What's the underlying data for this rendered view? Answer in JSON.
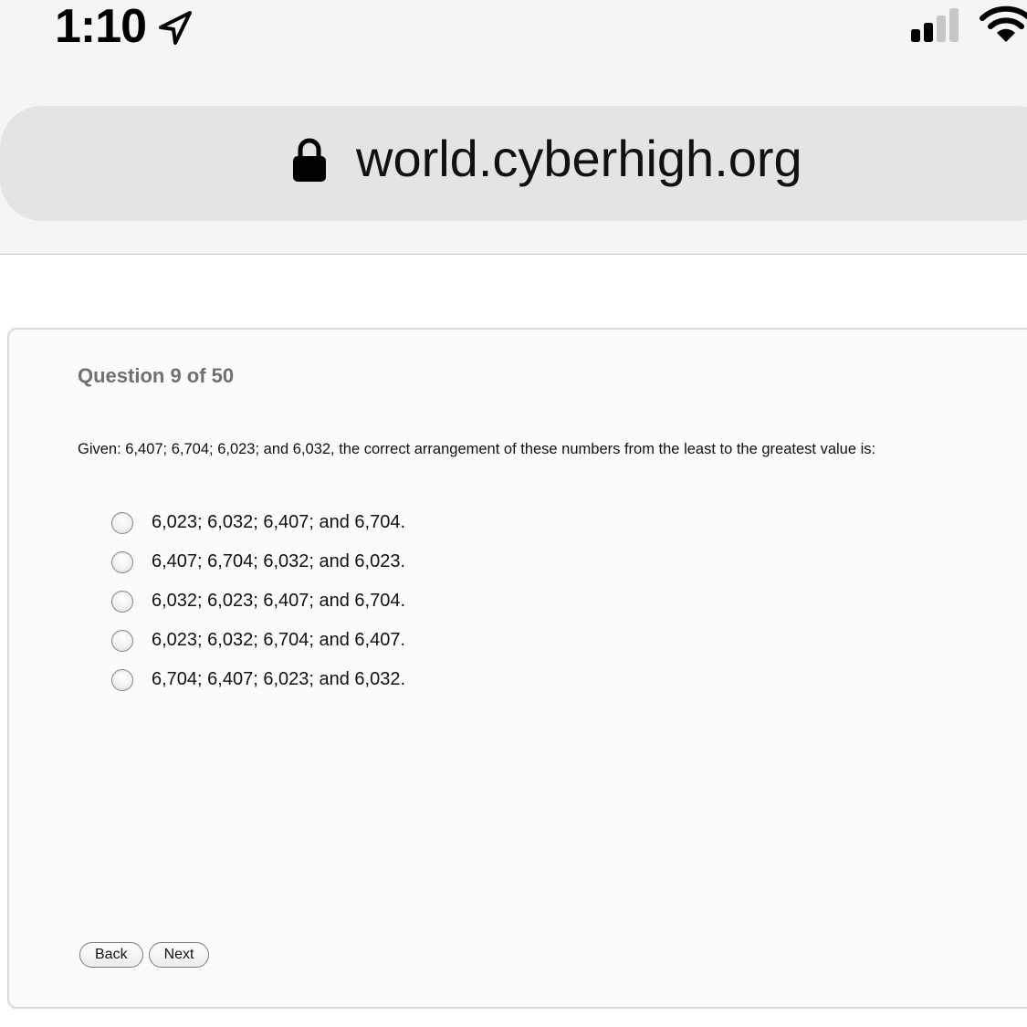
{
  "status_bar": {
    "time": "1:10",
    "location_icon": "location-arrow-icon",
    "signal_icon": "cellular-signal-icon",
    "wifi_icon": "wifi-icon"
  },
  "browser": {
    "url": "world.cyberhigh.org",
    "lock_icon": "lock-icon"
  },
  "quiz": {
    "question_label": "Question 9 of 50",
    "question_text": "Given: 6,407; 6,704; 6,023; and 6,032, the correct arrangement of these numbers from the least to the greatest value is:",
    "options": [
      "6,023; 6,032; 6,407; and 6,704.",
      "6,407; 6,704; 6,032; and 6,023.",
      "6,032; 6,023; 6,407; and 6,704.",
      "6,023; 6,032; 6,704; and 6,407.",
      "6,704; 6,407; 6,023; and 6,032."
    ],
    "buttons": {
      "back": "Back",
      "next": "Next"
    }
  }
}
